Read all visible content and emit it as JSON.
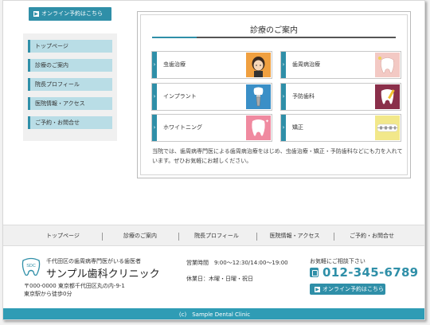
{
  "sidebar": {
    "online_label": "オンライン予約はこちら",
    "nav": [
      "トップページ",
      "診療のご案内",
      "院長プロフィール",
      "医院情報・アクセス",
      "ご予約・お問合せ"
    ]
  },
  "services": {
    "title": "診療のご案内",
    "cards": [
      {
        "label": "虫歯治療",
        "icon": "woman-toothache-icon"
      },
      {
        "label": "歯周病治療",
        "icon": "tooth-icon"
      },
      {
        "label": "インプラント",
        "icon": "implant-icon"
      },
      {
        "label": "予防歯科",
        "icon": "tooth-brush-icon"
      },
      {
        "label": "ホワイトニング",
        "icon": "white-tooth-icon"
      },
      {
        "label": "矯正",
        "icon": "braces-icon"
      }
    ],
    "description": "当院では、歯周病専門医による歯周病治療をはじめ、虫歯治療・矯正・予防歯科などにも力を入れています。ぜひお気軽にお越しください。"
  },
  "footer_nav": [
    "トップページ",
    "診療のご案内",
    "院長プロフィール",
    "医院情報・アクセス",
    "ご予約・お問合せ"
  ],
  "footer": {
    "logo_text": "SDC",
    "tagline": "千代田区の歯周病専門医がいる歯医者",
    "clinic_name": "サンプル歯科クリニック",
    "address_line1": "〒000-0000 東京都千代田区丸の内-9-1",
    "address_line2": "東京駅から徒歩0分",
    "hours": "営業時間　9:00～12:30/14:00～19:00",
    "holiday": "休業日：木曜・日曜・祝日",
    "consult": "お気軽にご相談下さい",
    "phone": "012-345-6789",
    "online_label": "オンライン予約はこちら"
  },
  "copyright": "(c)　Sample Dental Clinic",
  "colors": {
    "accent": "#2f8fa8",
    "nav_bg": "#b9dde6",
    "copyright_bg": "#2f9cb5"
  }
}
